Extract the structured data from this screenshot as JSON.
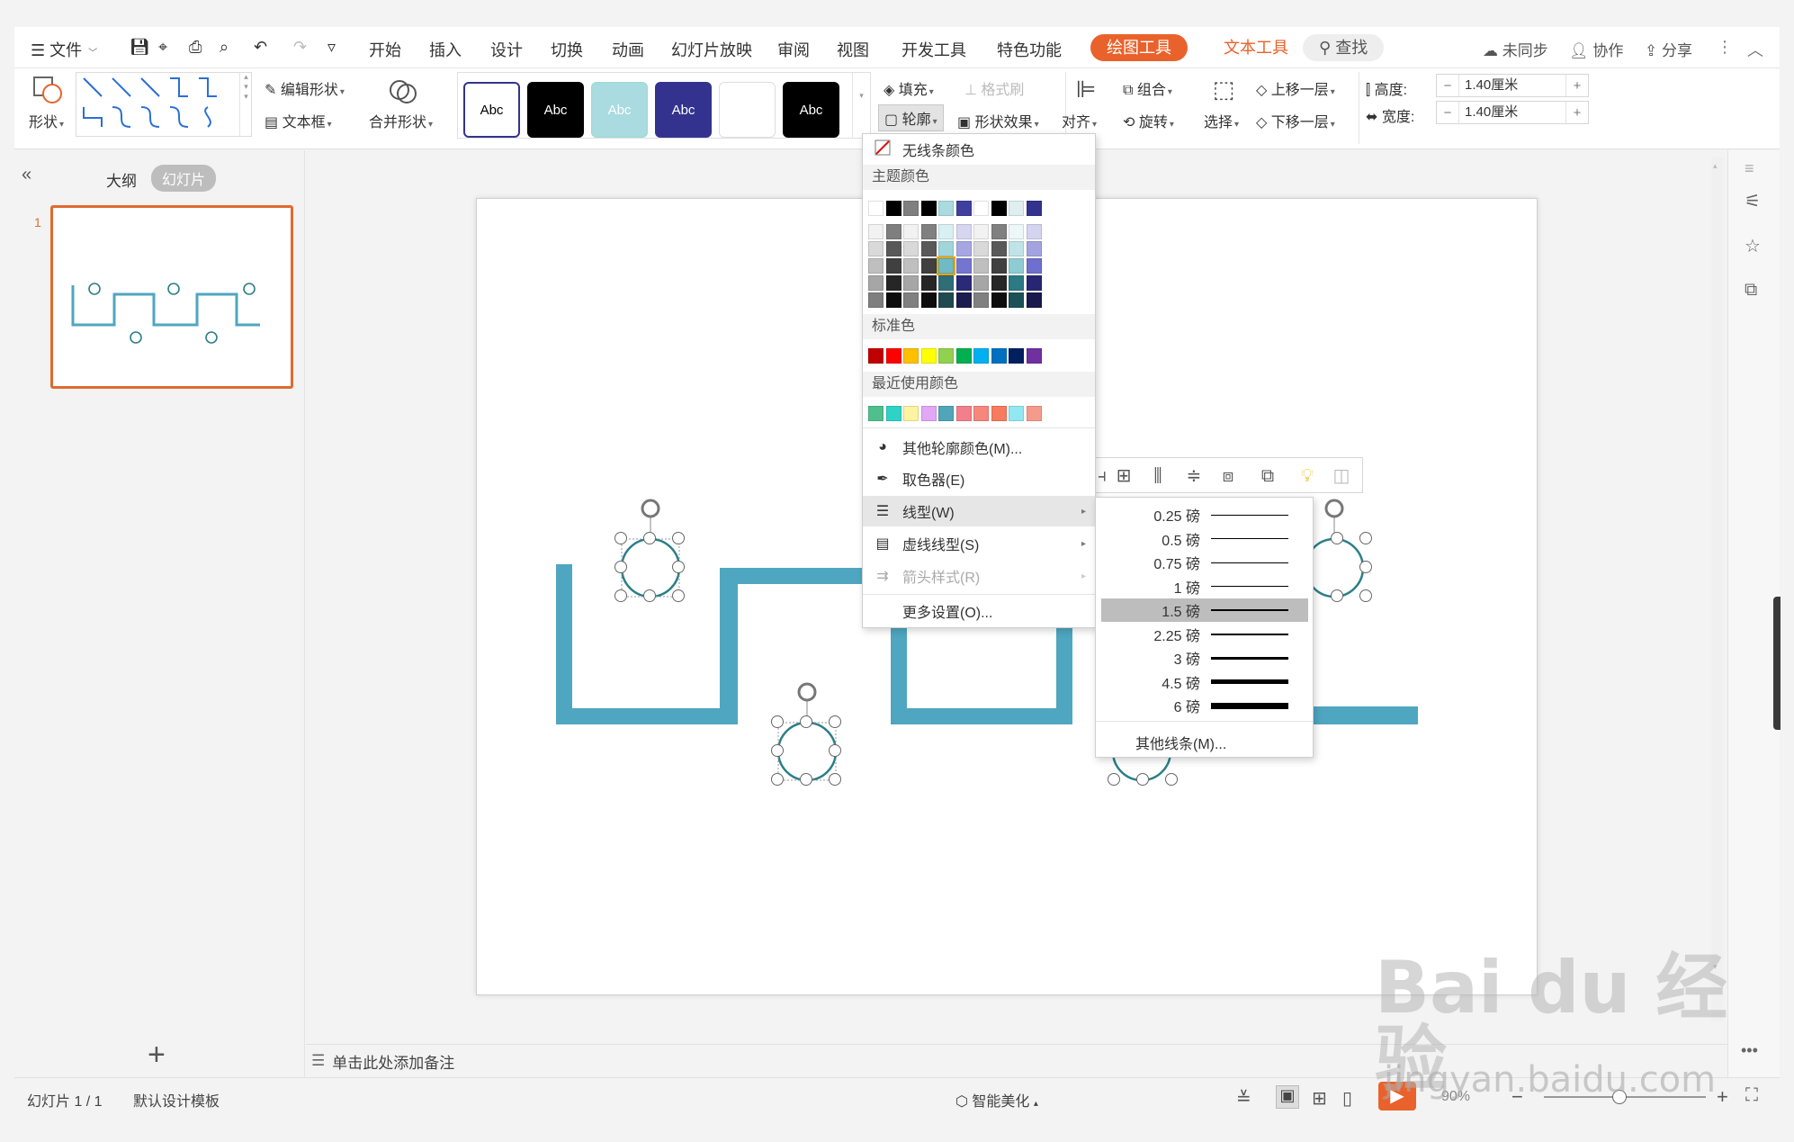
{
  "menubar": {
    "file": "文件",
    "items": [
      "开始",
      "插入",
      "设计",
      "切换",
      "动画",
      "幻灯片放映",
      "审阅",
      "视图",
      "开发工具",
      "特色功能"
    ],
    "drawing_tools": "绘图工具",
    "text_tools": "文本工具",
    "search": "查找",
    "sync": "未同步",
    "collab": "协作",
    "share": "分享"
  },
  "ribbon": {
    "shape": "形状",
    "edit_shape": "编辑形状",
    "textbox": "文本框",
    "merge_shape": "合并形状",
    "style_label": "Abc",
    "fill": "填充",
    "format_painter": "格式刷",
    "outline": "轮廓",
    "shape_effect": "形状效果",
    "align": "对齐",
    "group": "组合",
    "rotate": "旋转",
    "select": "选择",
    "bring_forward": "上移一层",
    "send_backward": "下移一层",
    "height_label": "高度:",
    "width_label": "宽度:",
    "height_value": "1.40厘米",
    "width_value": "1.40厘米"
  },
  "leftpane": {
    "outline_tab": "大纲",
    "slides_tab": "幻灯片",
    "slide_number": "1"
  },
  "outline_menu": {
    "no_line": "无线条颜色",
    "theme_colors": "主题颜色",
    "standard_colors": "标准色",
    "recent_colors": "最近使用颜色",
    "more_colors": "其他轮廓颜色(M)...",
    "eyedropper": "取色器(E)",
    "line_type": "线型(W)",
    "dash_type": "虚线线型(S)",
    "arrow_style": "箭头样式(R)",
    "more_settings": "更多设置(O)..."
  },
  "colors": {
    "theme_top": [
      "#ffffff",
      "#000000",
      "#7f7f7f",
      "#000000",
      "#a9dbe0",
      "#3f3f9f",
      "#ffffff",
      "#000000",
      "#dfeff1",
      "#33338f"
    ],
    "theme_columns": [
      [
        "#f2f2f2",
        "#d9d9d9",
        "#bfbfbf",
        "#a6a6a6",
        "#7f7f7f"
      ],
      [
        "#7f7f7f",
        "#595959",
        "#404040",
        "#262626",
        "#0d0d0d"
      ],
      [
        "#f2f2f2",
        "#d9d9d9",
        "#bfbfbf",
        "#a6a6a6",
        "#808080"
      ],
      [
        "#808080",
        "#595959",
        "#404040",
        "#262626",
        "#0d0d0d"
      ],
      [
        "#d9f0f2",
        "#9fd5db",
        "#6fbac4",
        "#2f6e77",
        "#1f4a50"
      ],
      [
        "#d6d6f2",
        "#a6a6e3",
        "#7575d1",
        "#2a2a78",
        "#1c1c50"
      ],
      [
        "#f2f2f2",
        "#d9d9d9",
        "#bfbfbf",
        "#a6a6a6",
        "#808080"
      ],
      [
        "#808080",
        "#595959",
        "#404040",
        "#262626",
        "#0d0d0d"
      ],
      [
        "#eef7f8",
        "#bfe3e7",
        "#8fcbd3",
        "#2b7a84",
        "#1c5158"
      ],
      [
        "#d4d4f0",
        "#a3a3e0",
        "#6f6fcf",
        "#262673",
        "#19194d"
      ]
    ],
    "standard": [
      "#c00000",
      "#ff0000",
      "#ffc000",
      "#ffff00",
      "#92d050",
      "#00b050",
      "#00b0f0",
      "#0070c0",
      "#002060",
      "#7030a0"
    ],
    "recent": [
      "#4fc08d",
      "#2ed3c6",
      "#fdf3a0",
      "#e2a7f5",
      "#4fa6b8",
      "#f37f8c",
      "#f6877a",
      "#f77b5e",
      "#92e8f2",
      "#f59b8b"
    ],
    "shape_teal": "#4fa6c0",
    "circle_stroke": "#2b7f88",
    "accent_orange": "#e9622b"
  },
  "line_weights": [
    {
      "label": "0.25 磅",
      "weight": 0.25
    },
    {
      "label": "0.5 磅",
      "weight": 0.5
    },
    {
      "label": "0.75 磅",
      "weight": 0.75
    },
    {
      "label": "1 磅",
      "weight": 1
    },
    {
      "label": "1.5 磅",
      "weight": 1.5,
      "selected": true
    },
    {
      "label": "2.25 磅",
      "weight": 2.25
    },
    {
      "label": "3 磅",
      "weight": 3
    },
    {
      "label": "4.5 磅",
      "weight": 4.5
    },
    {
      "label": "6 磅",
      "weight": 6
    }
  ],
  "line_submenu_more": "其他线条(M)...",
  "notes_placeholder": "单击此处添加备注",
  "statusbar": {
    "slide_info": "幻灯片 1 / 1",
    "template": "默认设计模板",
    "smart_beautify": "智能美化",
    "zoom": "90%"
  },
  "watermark": {
    "brand": "Bai du 经验",
    "url": "jingyan.baidu.com"
  }
}
